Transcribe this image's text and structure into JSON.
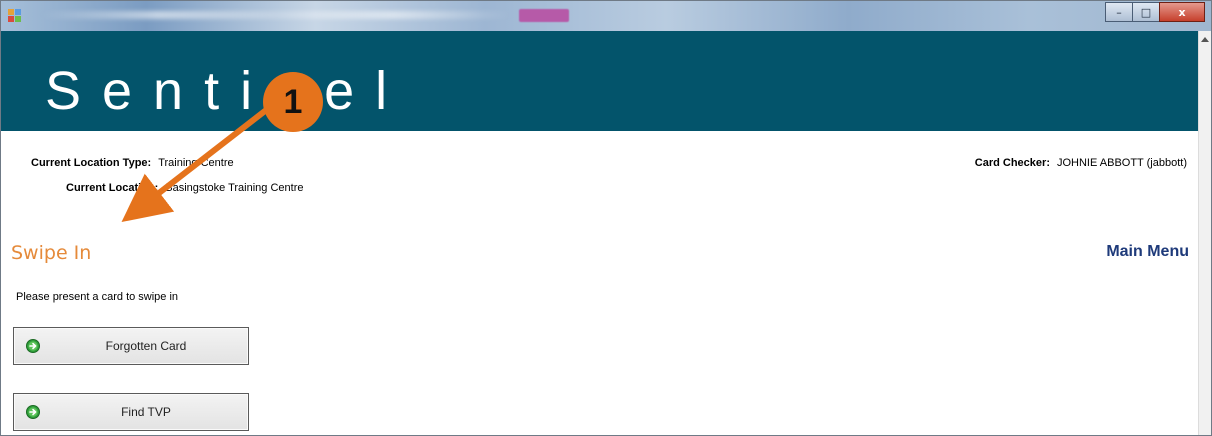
{
  "window": {
    "controls": {
      "minimize": "–",
      "maximize": "□",
      "close": "x"
    }
  },
  "banner": {
    "brand": "Sentinel"
  },
  "info": {
    "location_type_label": "Current Location Type:",
    "location_type_value": "Training Centre",
    "location_label": "Current Location:",
    "location_value": "Basingstoke Training Centre",
    "checker_label": "Card Checker:",
    "checker_value": "JOHNIE ABBOTT (jabbott)"
  },
  "page": {
    "title": "Swipe In",
    "main_menu": "Main Menu",
    "prompt": "Please present a card to swipe in"
  },
  "buttons": {
    "forgotten_card": "Forgotten Card",
    "find_tvp": "Find TVP"
  },
  "annotation": {
    "marker_number": "1"
  },
  "colors": {
    "banner": "#03546b",
    "title_accent": "#e58a3a",
    "main_menu": "#1e3a7a",
    "annotation": "#e5731c"
  },
  "icons": {
    "app": "app-icon",
    "button": "green-arrow-circle-icon"
  }
}
